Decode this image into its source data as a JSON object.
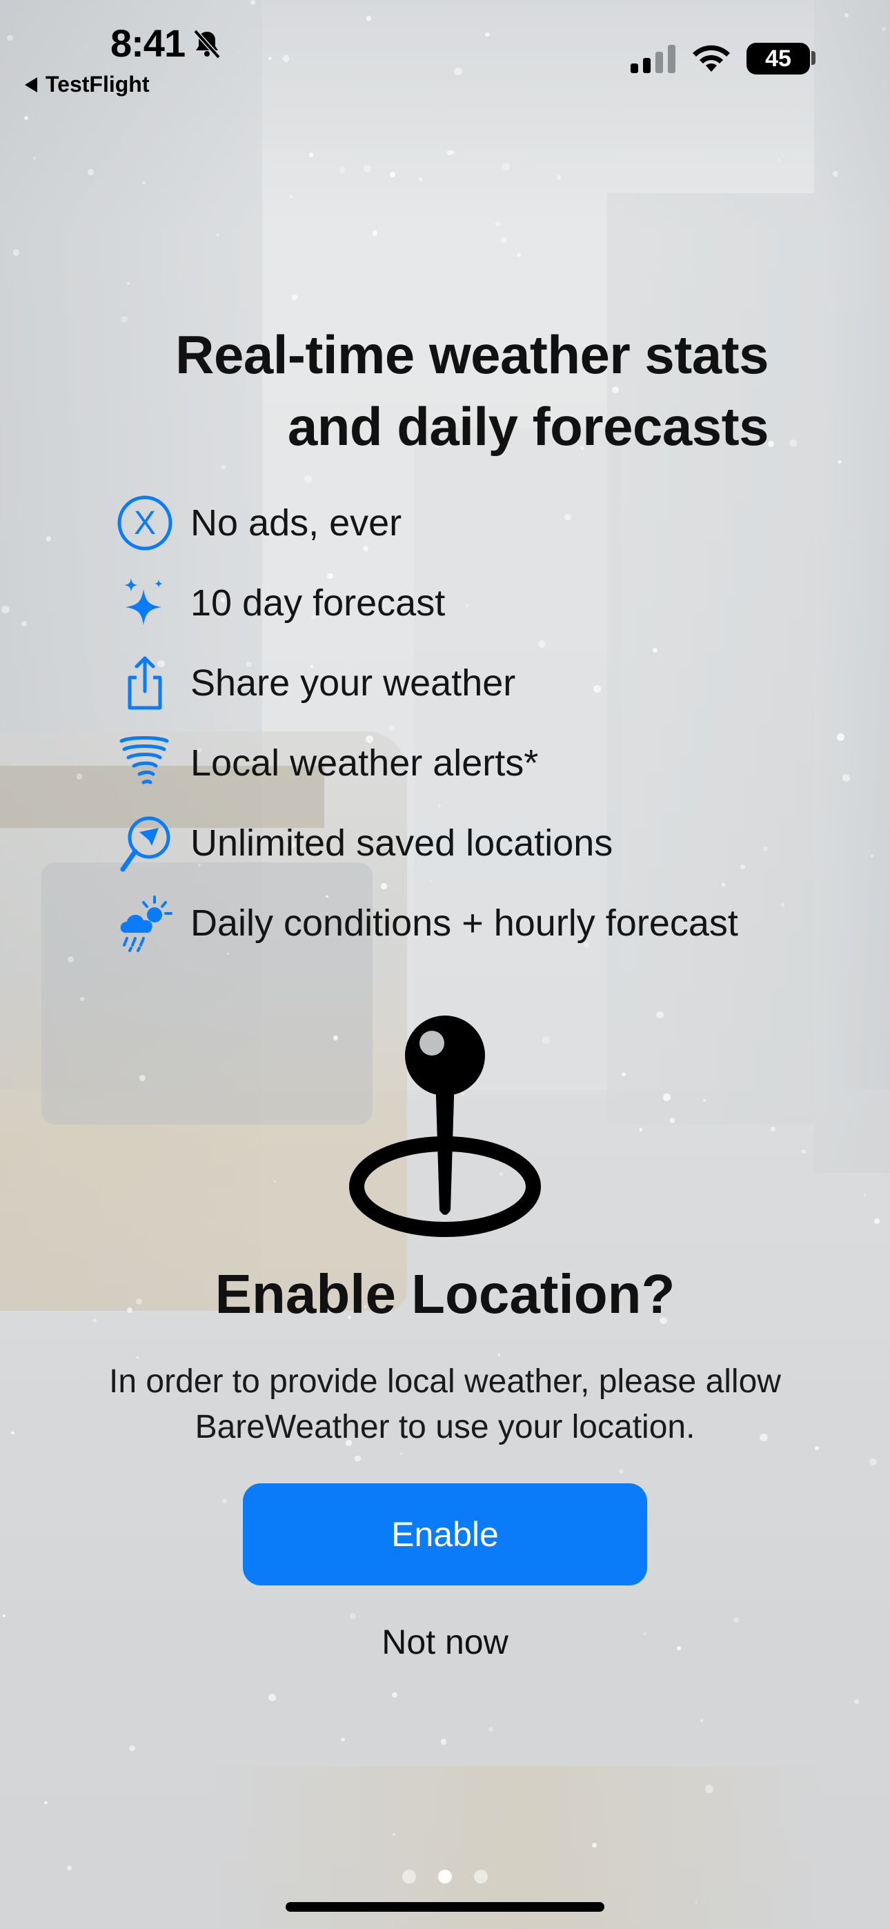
{
  "status_bar": {
    "time": "8:41",
    "back_label": "TestFlight",
    "battery": "45",
    "icons": [
      "bell-slash-icon",
      "cellular-signal-icon",
      "wifi-icon",
      "battery-icon"
    ]
  },
  "headline": {
    "line1": "Real-time weather stats",
    "line2": "and daily forecasts"
  },
  "features": [
    {
      "icon": "x-circle-icon",
      "label": "No ads, ever"
    },
    {
      "icon": "sparkles-icon",
      "label": "10 day forecast"
    },
    {
      "icon": "share-icon",
      "label": "Share your weather"
    },
    {
      "icon": "tornado-icon",
      "label": "Local weather alerts*"
    },
    {
      "icon": "location-search-icon",
      "label": "Unlimited saved locations"
    },
    {
      "icon": "cloud-sun-rain-icon",
      "label": "Daily conditions + hourly forecast"
    }
  ],
  "location_prompt": {
    "icon": "map-pin-icon",
    "title": "Enable Location?",
    "body": "In order to provide local weather, please allow BareWeather to use your location.",
    "enable_label": "Enable",
    "not_now_label": "Not now"
  },
  "pager": {
    "count": 3,
    "active_index": 1
  },
  "colors": {
    "accent": "#0A7CF9",
    "text": "#111111",
    "button_text": "#FFFFFF"
  }
}
